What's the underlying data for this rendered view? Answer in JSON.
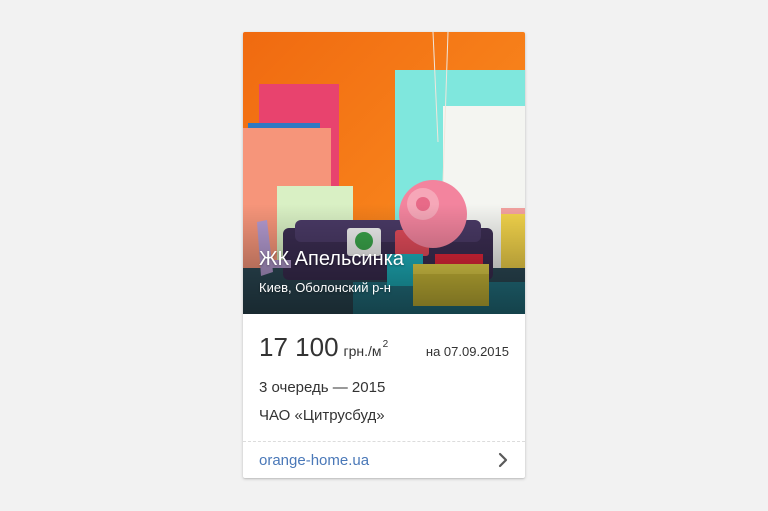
{
  "listing": {
    "title": "ЖК Апельсинка",
    "location": "Киев, Оболонский р-н",
    "price_value": "17 100",
    "price_unit": "грн./м",
    "price_unit_sup": "2",
    "price_date": "на 07.09.2015",
    "stage": "3 очередь — 2015",
    "developer": "ЧАО «Цитрусбуд»",
    "website": "orange-home.ua"
  },
  "icons": {
    "photo": "interior-photo",
    "chevron": "chevron-right-icon"
  },
  "colors": {
    "link": "#4a78b8",
    "photo_background": "#f27512"
  }
}
